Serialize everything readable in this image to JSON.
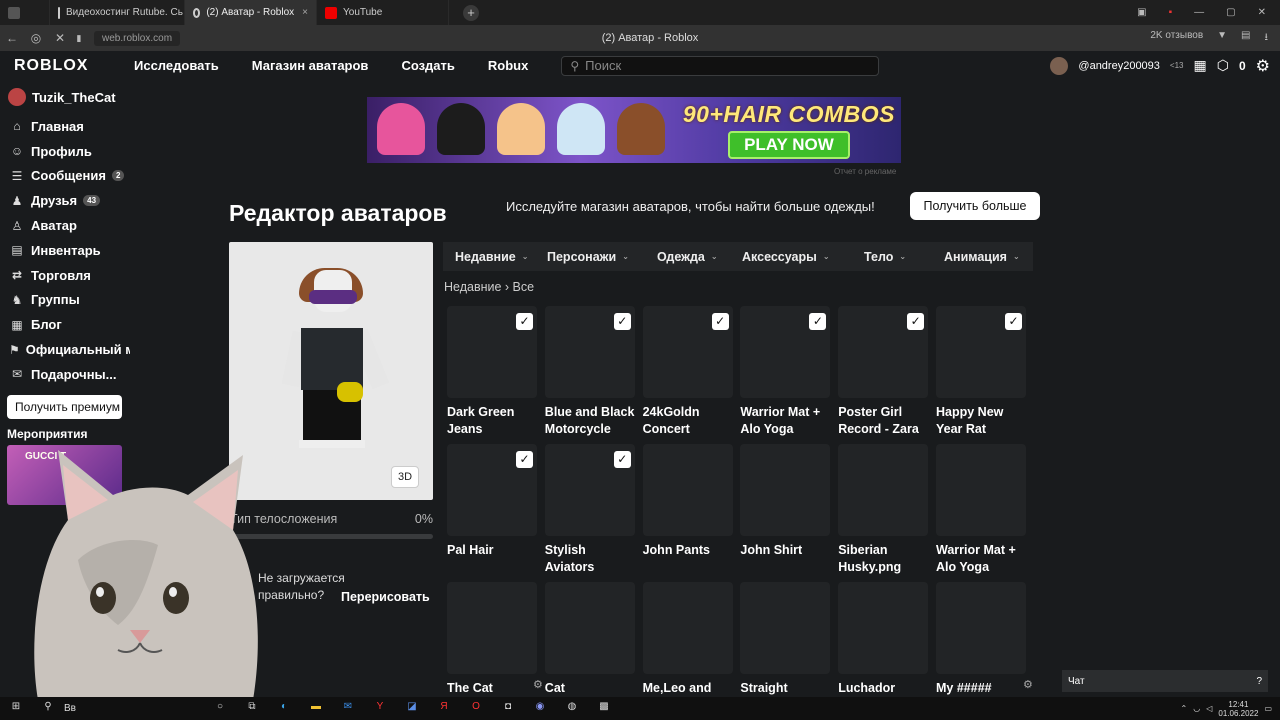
{
  "browser": {
    "tabs": [
      {
        "label": "Видеохостинг Rutube. Сь",
        "close": "×"
      },
      {
        "label": "(2) Аватар - Roblox",
        "close": "×"
      },
      {
        "label": "YouTube",
        "close": ""
      }
    ],
    "new_tab": "+",
    "url": "web.roblox.com",
    "page_title": "(2) Аватар - Roblox",
    "extension_label": "2K отзывов"
  },
  "header": {
    "logo": "ROBLOX",
    "nav": [
      "Исследовать",
      "Магазин аватаров",
      "Создать",
      "Robux"
    ],
    "search_placeholder": "Поиск",
    "username": "@andrey200093",
    "age": "<13",
    "robux": "0"
  },
  "sidebar": {
    "user": "Tuzik_TheCat",
    "items": [
      {
        "label": "Главная",
        "icon": "⌂"
      },
      {
        "label": "Профиль",
        "icon": "☺"
      },
      {
        "label": "Сообщения",
        "icon": "☰",
        "badge": "2"
      },
      {
        "label": "Друзья",
        "icon": "♟",
        "badge": "43"
      },
      {
        "label": "Аватар",
        "icon": "♙"
      },
      {
        "label": "Инвентарь",
        "icon": "▤"
      },
      {
        "label": "Торговля",
        "icon": "⇄"
      },
      {
        "label": "Группы",
        "icon": "♞"
      },
      {
        "label": "Блог",
        "icon": "▦"
      },
      {
        "label": "Официальный ма",
        "icon": "⚑"
      },
      {
        "label": "Подарочны...",
        "icon": "✉"
      }
    ],
    "premium_button": "Получить премиум",
    "events_label": "Мероприятия",
    "sponsor_text": "GUCCI T"
  },
  "ad": {
    "combo_text": "90+HAIR COMBOS",
    "play_text": "PLAY NOW",
    "report_text": "Отчет о рекламе"
  },
  "editor": {
    "title": "Редактор аватаров",
    "explore_text": "Исследуйте магазин аватаров, чтобы найти больше одежды!",
    "more_button": "Получить больше",
    "btn_3d": "3D",
    "body_type_label": "Тип телосложения",
    "body_type_value": "0%",
    "body_type_fraction": 0,
    "loading_q": "Не загружается правильно?",
    "redraw": "Перерисовать",
    "tabs": [
      "Недавние",
      "Персонажи",
      "Одежда",
      "Аксессуары",
      "Тело",
      "Анимация"
    ],
    "breadcrumb": "Недавние › Все"
  },
  "items": [
    {
      "name": "Dark Green Jeans",
      "checked": true
    },
    {
      "name": "Blue and Black Motorcycle",
      "checked": true
    },
    {
      "name": "24kGoldn Concert",
      "checked": true
    },
    {
      "name": "Warrior Mat + Alo Yoga",
      "checked": true
    },
    {
      "name": "Poster Girl Record - Zara",
      "checked": true
    },
    {
      "name": "Happy New Year Rat",
      "checked": true
    },
    {
      "name": "Pal Hair",
      "checked": true
    },
    {
      "name": "Stylish Aviators",
      "checked": true
    },
    {
      "name": "John Pants",
      "checked": false
    },
    {
      "name": "John Shirt",
      "checked": false
    },
    {
      "name": "Siberian Husky.png",
      "checked": false
    },
    {
      "name": "Warrior Mat + Alo Yoga",
      "checked": false
    },
    {
      "name": "The Cat",
      "checked": false
    },
    {
      "name": "Cat",
      "checked": false
    },
    {
      "name": "Me,Leo and",
      "checked": false
    },
    {
      "name": "Straight",
      "checked": false
    },
    {
      "name": "Luchador",
      "checked": false
    },
    {
      "name": "My #####",
      "checked": false
    }
  ],
  "chat_label": "Чат",
  "taskbar": {
    "search_label": "Вв",
    "time": "12:41",
    "date": "01.06.2022"
  }
}
